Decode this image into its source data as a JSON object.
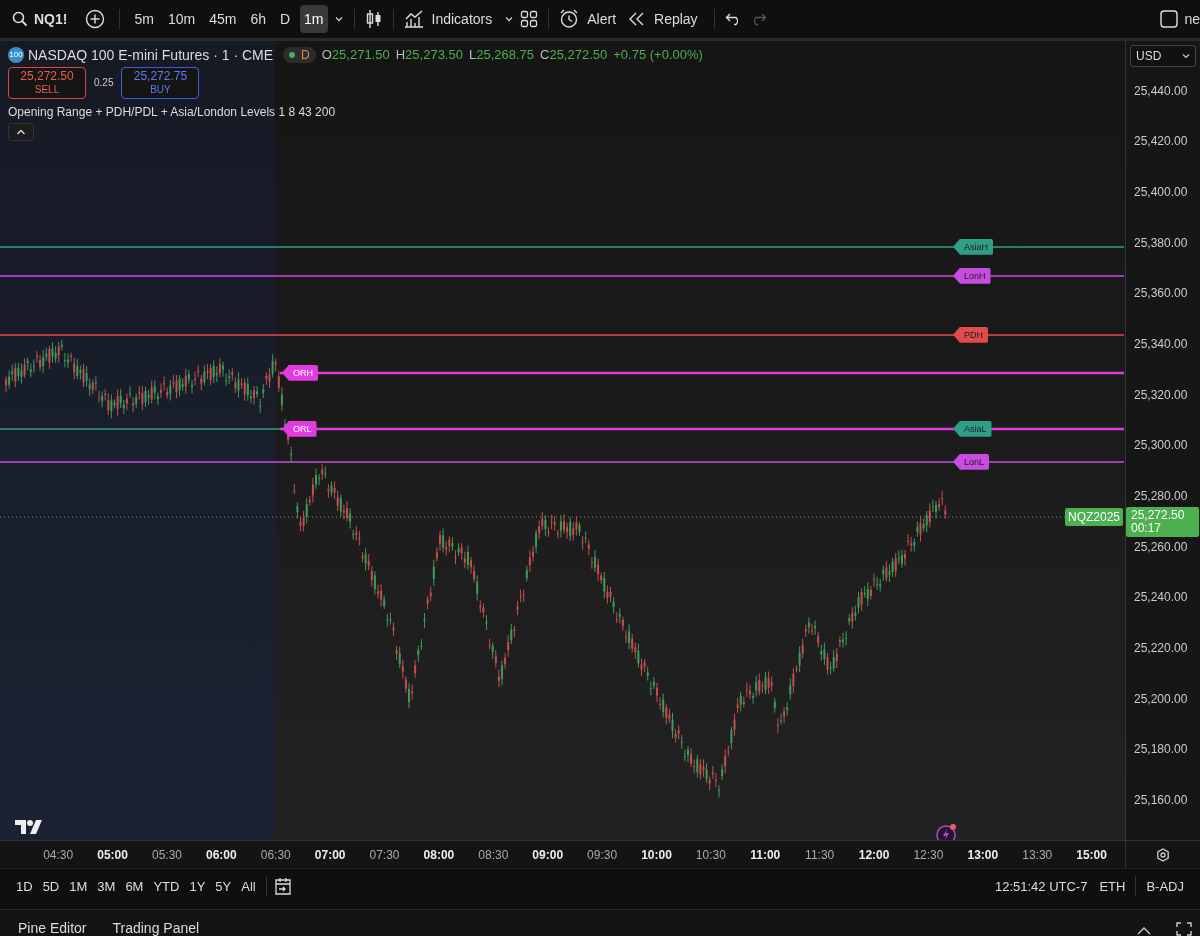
{
  "toolbar": {
    "symbol": "NQ1!",
    "intervals": [
      {
        "label": "5m",
        "selected": false
      },
      {
        "label": "10m",
        "selected": false
      },
      {
        "label": "45m",
        "selected": false
      },
      {
        "label": "6h",
        "selected": false
      },
      {
        "label": "D",
        "selected": false
      },
      {
        "label": "1m",
        "selected": true
      }
    ],
    "indicators": "Indicators",
    "alert": "Alert",
    "replay": "Replay",
    "cut_text": "ne"
  },
  "legend": {
    "badge": "100",
    "title": "NASDAQ 100 E-mini Futures · 1 · CME",
    "session": "D",
    "ohlc": [
      {
        "key": "O",
        "value": "25,271.50"
      },
      {
        "key": "H",
        "value": "25,273.50"
      },
      {
        "key": "L",
        "value": "25,268.75"
      },
      {
        "key": "C",
        "value": "25,272.50"
      }
    ],
    "change": "+0.75 (+0.00%)"
  },
  "trade": {
    "sell_price": "25,272.50",
    "sell": "SELL",
    "spread": "0.25",
    "buy_price": "25,272.75",
    "buy": "BUY"
  },
  "indicator": "Opening Range + PDH/PDL + Asia/London Levels 1 8 43 200",
  "currency": "USD",
  "price_axis": [
    "25,440.00",
    "25,420.00",
    "25,400.00",
    "25,380.00",
    "25,360.00",
    "25,340.00",
    "25,320.00",
    "25,300.00",
    "25,280.00",
    "25,260.00",
    "25,240.00",
    "25,220.00",
    "25,200.00",
    "25,180.00",
    "25,160.00"
  ],
  "levels": [
    {
      "label": "AsiaH",
      "color": "#2e9e86",
      "kind": "session"
    },
    {
      "label": "LonH",
      "color": "#c94ce0",
      "kind": "session"
    },
    {
      "label": "PDH",
      "color": "#e04b4b",
      "kind": "session"
    },
    {
      "label": "ORH",
      "color": "#e23ce0",
      "kind": "range"
    },
    {
      "label": "ORL",
      "color": "#e23ce0",
      "kind": "range"
    },
    {
      "label": "AsiaL",
      "color": "#2e9e86",
      "kind": "session"
    },
    {
      "label": "LonL",
      "color": "#c94ce0",
      "kind": "session"
    }
  ],
  "last_price": {
    "symbol": "NQZ2025",
    "price": "25,272.50",
    "countdown": "00:17"
  },
  "time_axis": [
    {
      "label": "04:30",
      "major": false
    },
    {
      "label": "05:00",
      "major": true
    },
    {
      "label": "05:30",
      "major": false
    },
    {
      "label": "06:00",
      "major": true
    },
    {
      "label": "06:30",
      "major": false
    },
    {
      "label": "07:00",
      "major": true
    },
    {
      "label": "07:30",
      "major": false
    },
    {
      "label": "08:00",
      "major": true
    },
    {
      "label": "08:30",
      "major": false
    },
    {
      "label": "09:00",
      "major": true
    },
    {
      "label": "09:30",
      "major": false
    },
    {
      "label": "10:00",
      "major": true
    },
    {
      "label": "10:30",
      "major": false
    },
    {
      "label": "11:00",
      "major": true
    },
    {
      "label": "11:30",
      "major": false
    },
    {
      "label": "12:00",
      "major": true
    },
    {
      "label": "12:30",
      "major": false
    },
    {
      "label": "13:00",
      "major": true
    },
    {
      "label": "13:30",
      "major": false
    },
    {
      "label": "15:00",
      "major": true
    }
  ],
  "ranges": [
    "1D",
    "5D",
    "1M",
    "3M",
    "6M",
    "YTD",
    "1Y",
    "5Y",
    "All"
  ],
  "status": {
    "time": "12:51:42 UTC-7",
    "session": "ETH",
    "adjust": "B-ADJ"
  },
  "panel_tabs": [
    "Pine Editor",
    "Trading Panel"
  ]
}
